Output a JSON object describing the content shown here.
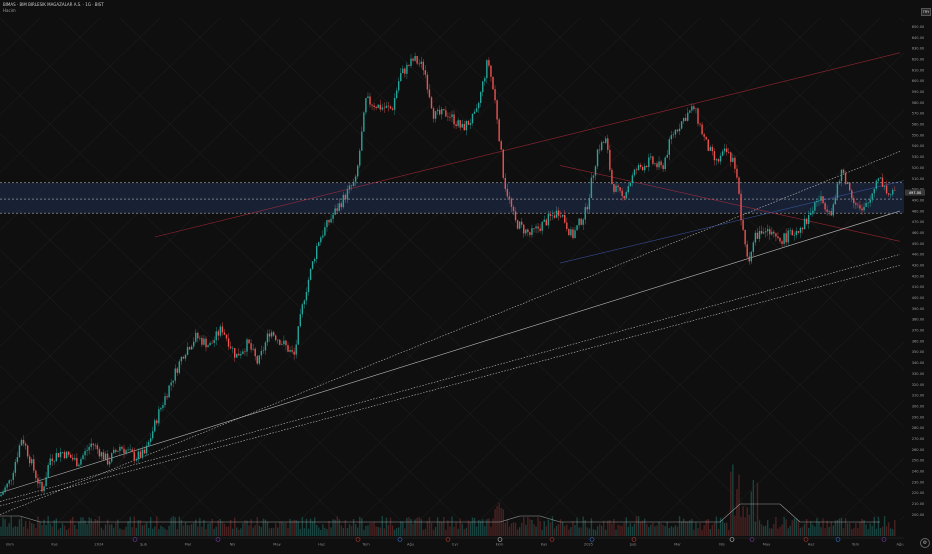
{
  "legend": {
    "title": "BIMAS · BIM BIRLESIK MAGAZALAR A.S. · 1G · BIST",
    "subtitle": "Hacim"
  },
  "top_badge": "TRY",
  "colors": {
    "up": "#26a69a",
    "down": "#ef5350",
    "zone_fill": "#1c2a44",
    "zone_line": "#cfcfcf",
    "red_channel": "#b02a3a",
    "white_trend": "#d8d8d8",
    "blue_line": "#3a58a8",
    "grid": "#232323"
  },
  "chart_data": {
    "type": "candlestick",
    "x_ticks": [
      "Ekm",
      "Kas",
      "2024",
      "Şub",
      "Mar",
      "Nis",
      "May",
      "Haz",
      "Tem",
      "Ağu",
      "Eyl",
      "Ekm",
      "Kas",
      "2025",
      "Şub",
      "Mar",
      "Nis",
      "May",
      "Haz",
      "Tem",
      "Ağu"
    ],
    "y_ticks": [
      200,
      210,
      220,
      230,
      240,
      250,
      260,
      270,
      280,
      290,
      300,
      310,
      320,
      330,
      340,
      350,
      360,
      370,
      380,
      390,
      400,
      410,
      420,
      430,
      440,
      450,
      460,
      470,
      480,
      490,
      500,
      510,
      520,
      530,
      540,
      550,
      560,
      570,
      580,
      590,
      600,
      610,
      620,
      630,
      640,
      650
    ],
    "ylim": [
      195,
      658
    ],
    "price_label": 497,
    "zone": {
      "top": 506,
      "mid": 491,
      "bottom": 478
    },
    "anchors": [
      [
        0,
        217
      ],
      [
        10,
        231
      ],
      [
        22,
        272
      ],
      [
        35,
        238
      ],
      [
        42,
        221
      ],
      [
        50,
        252
      ],
      [
        62,
        258
      ],
      [
        78,
        248
      ],
      [
        92,
        266
      ],
      [
        108,
        249
      ],
      [
        120,
        263
      ],
      [
        135,
        253
      ],
      [
        145,
        256
      ],
      [
        158,
        292
      ],
      [
        170,
        320
      ],
      [
        184,
        350
      ],
      [
        196,
        364
      ],
      [
        210,
        356
      ],
      [
        222,
        372
      ],
      [
        236,
        346
      ],
      [
        248,
        358
      ],
      [
        258,
        339
      ],
      [
        270,
        370
      ],
      [
        285,
        356
      ],
      [
        294,
        346
      ],
      [
        304,
        400
      ],
      [
        318,
        452
      ],
      [
        330,
        472
      ],
      [
        348,
        498
      ],
      [
        356,
        508
      ],
      [
        366,
        582
      ],
      [
        380,
        576
      ],
      [
        392,
        574
      ],
      [
        400,
        605
      ],
      [
        414,
        620
      ],
      [
        424,
        612
      ],
      [
        434,
        568
      ],
      [
        448,
        570
      ],
      [
        462,
        556
      ],
      [
        476,
        568
      ],
      [
        488,
        620
      ],
      [
        496,
        576
      ],
      [
        504,
        508
      ],
      [
        515,
        470
      ],
      [
        530,
        458
      ],
      [
        548,
        472
      ],
      [
        560,
        481
      ],
      [
        572,
        456
      ],
      [
        586,
        480
      ],
      [
        598,
        538
      ],
      [
        606,
        545
      ],
      [
        612,
        505
      ],
      [
        622,
        492
      ],
      [
        636,
        518
      ],
      [
        650,
        526
      ],
      [
        662,
        519
      ],
      [
        672,
        550
      ],
      [
        686,
        568
      ],
      [
        694,
        575
      ],
      [
        706,
        542
      ],
      [
        716,
        524
      ],
      [
        726,
        535
      ],
      [
        736,
        522
      ],
      [
        742,
        464
      ],
      [
        748,
        434
      ],
      [
        756,
        458
      ],
      [
        766,
        462
      ],
      [
        778,
        452
      ],
      [
        792,
        459
      ],
      [
        806,
        470
      ],
      [
        818,
        492
      ],
      [
        832,
        480
      ],
      [
        842,
        518
      ],
      [
        852,
        494
      ],
      [
        862,
        478
      ],
      [
        870,
        490
      ],
      [
        878,
        514
      ],
      [
        888,
        496
      ],
      [
        895,
        495
      ]
    ],
    "volume_level": 0.35
  }
}
